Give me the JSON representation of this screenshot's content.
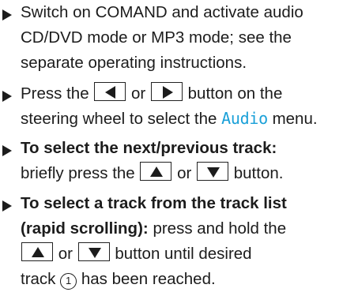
{
  "step1": {
    "line1": "Switch on COMAND and activate audio",
    "line2": "CD/DVD mode or MP3 mode; see the",
    "line3": "separate operating instructions."
  },
  "step2": {
    "line1_pre": "Press the",
    "left_button_icon": "left-arrow-icon",
    "or1": "or",
    "right_button_icon": "right-arrow-icon",
    "line1_post": "button on the",
    "line2_pre": "steering wheel to select the",
    "menu_name": "Audio",
    "line2_post": "menu.",
    "accent_color": "#1aa0d8"
  },
  "step3": {
    "heading": "To select the next/previous track:",
    "line2_pre": "briefly press the",
    "up_button_icon": "up-arrow-icon",
    "or": "or",
    "down_button_icon": "down-arrow-icon",
    "line2_post": "button."
  },
  "step4": {
    "heading_line1": "To select a track from the track list",
    "heading_line2": "(rapid scrolling):",
    "line2_post": "press and hold the",
    "or": "or",
    "line3_post": "button until desired",
    "line4_pre": "track",
    "callout": "1",
    "line4_post": "has been reached."
  }
}
